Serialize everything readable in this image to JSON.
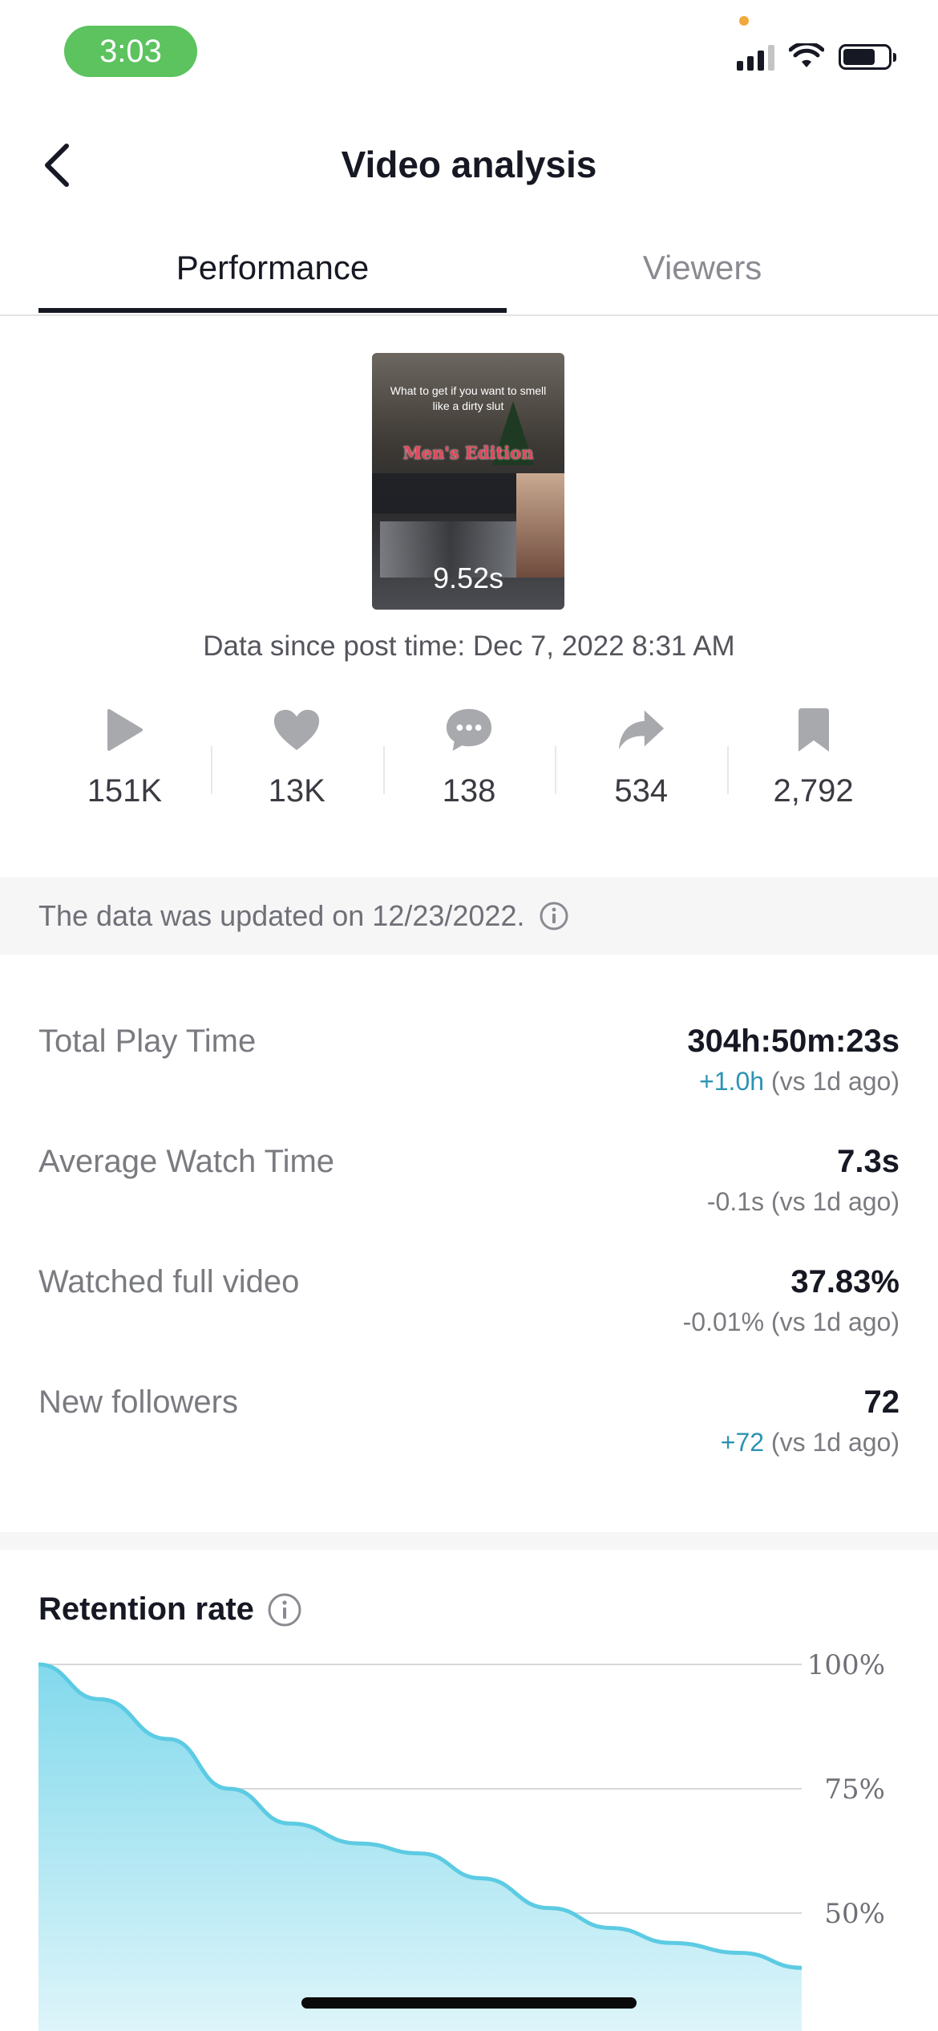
{
  "status_bar": {
    "time": "3:03"
  },
  "header": {
    "title": "Video analysis",
    "back_icon": "chevron-left-icon"
  },
  "tabs": [
    {
      "label": "Performance",
      "active": true
    },
    {
      "label": "Viewers",
      "active": false
    }
  ],
  "video": {
    "caption": "What to get if you want to smell like a dirty slut",
    "edition_text": "Men's Edition",
    "duration": "9.52s",
    "post_time": "Data since post time: Dec 7, 2022 8:31 AM"
  },
  "stats": [
    {
      "icon": "play-icon",
      "value": "151K"
    },
    {
      "icon": "heart-icon",
      "value": "13K"
    },
    {
      "icon": "comment-icon",
      "value": "138"
    },
    {
      "icon": "share-icon",
      "value": "534"
    },
    {
      "icon": "bookmark-icon",
      "value": "2,792"
    }
  ],
  "updated_notice": "The data was updated on 12/23/2022.",
  "metrics": [
    {
      "label": "Total Play Time",
      "value": "304h:50m:23s",
      "delta": "+1.0h",
      "delta_note": "(vs 1d ago)"
    },
    {
      "label": "Average Watch Time",
      "value": "7.3s",
      "delta": "-0.1s",
      "delta_note": "(vs 1d ago)"
    },
    {
      "label": "Watched full video",
      "value": "37.83%",
      "delta": "-0.01%",
      "delta_note": "(vs 1d ago)"
    },
    {
      "label": "New followers",
      "value": "72",
      "delta": "+72",
      "delta_note": "(vs 1d ago)"
    }
  ],
  "retention": {
    "title": "Retention rate",
    "chart_data": {
      "type": "area",
      "title": "Retention rate",
      "x": [
        0,
        0.08,
        0.17,
        0.25,
        0.33,
        0.42,
        0.5,
        0.58,
        0.67,
        0.75,
        0.83,
        0.92,
        1.0
      ],
      "y": [
        100,
        93,
        85,
        75,
        68,
        64,
        62,
        57,
        51,
        47,
        44,
        42,
        39
      ],
      "yticks": [
        "100%",
        "75%",
        "50%"
      ],
      "ylim": [
        50,
        100
      ],
      "grid": true,
      "accent_color": "#5ccbe3"
    }
  },
  "colors": {
    "positive_delta": "#2e93b4",
    "status_green": "#5cc35f"
  }
}
